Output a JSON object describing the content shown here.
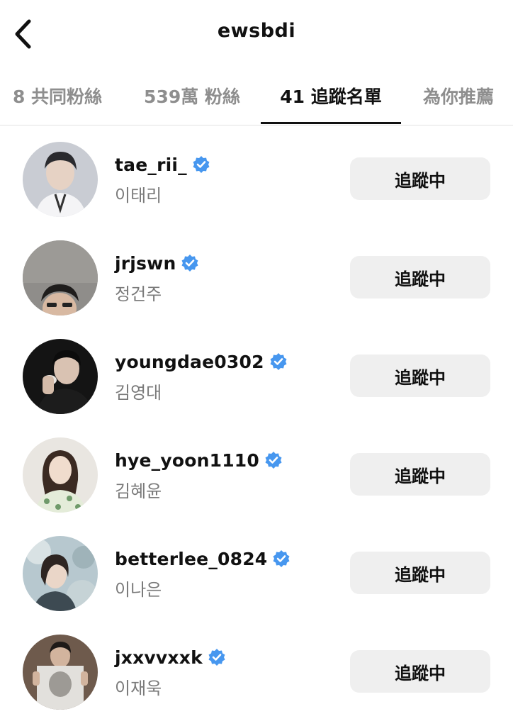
{
  "header": {
    "title": "ewsbdi",
    "back_icon": "chevron-left-icon"
  },
  "tabs": [
    {
      "label": "8 共同粉絲",
      "active": false
    },
    {
      "label": "539萬 粉絲",
      "active": false
    },
    {
      "label": "41 追蹤名單",
      "active": true
    },
    {
      "label": "為你推薦",
      "active": false
    }
  ],
  "colors": {
    "verified_badge": "#4797ef",
    "button_bg": "#efefef",
    "inactive_tab": "#8e8e8e",
    "secondary_text": "#7a7a7a"
  },
  "users": [
    {
      "username": "tae_rii_",
      "full_name": "이태리",
      "verified": true,
      "button_label": "追蹤中"
    },
    {
      "username": "jrjswn",
      "full_name": "정건주",
      "verified": true,
      "button_label": "追蹤中"
    },
    {
      "username": "youngdae0302",
      "full_name": "김영대",
      "verified": true,
      "button_label": "追蹤中"
    },
    {
      "username": "hye_yoon1110",
      "full_name": "김혜윤",
      "verified": true,
      "button_label": "追蹤中"
    },
    {
      "username": "betterlee_0824",
      "full_name": "이나은",
      "verified": true,
      "button_label": "追蹤中"
    },
    {
      "username": "jxxvvxxk",
      "full_name": "이재욱",
      "verified": true,
      "button_label": "追蹤中"
    }
  ]
}
